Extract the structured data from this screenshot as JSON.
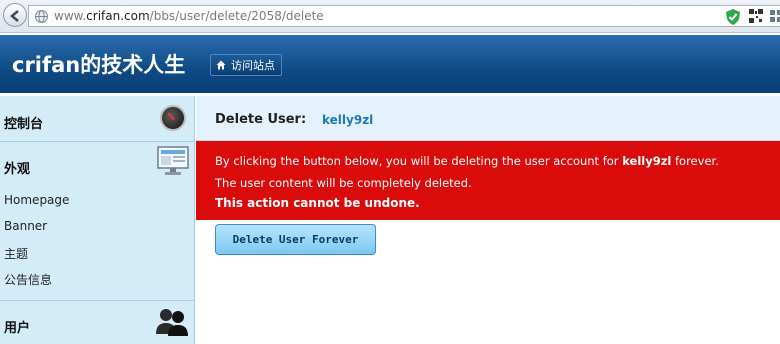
{
  "browser": {
    "url_prefix": "www.",
    "url_host": "crifan.com",
    "url_path": "/bbs/user/delete/2058/delete"
  },
  "header": {
    "site_title": "crifan的技术人生",
    "visit_site_label": "访问站点"
  },
  "sidebar": {
    "dashboard": "控制台",
    "appearance": "外观",
    "appearance_items": [
      "Homepage",
      "Banner",
      "主题",
      "公告信息"
    ],
    "users": "用户"
  },
  "main": {
    "delete_user_label": "Delete User:",
    "username": "kelly9zl",
    "warning": {
      "line1_before": "By clicking the button below, you will be deleting the user account for ",
      "line1_user": "kelly9zl",
      "line1_after": " forever.",
      "line2": "The user content will be completely deleted.",
      "line3": "This action cannot be undone."
    },
    "delete_button": "Delete User Forever"
  },
  "colors": {
    "header_blue": "#0f4a85",
    "sidebar_bg": "#d4ecf8",
    "warning_red": "#d90b0b",
    "username_link": "#1f7ab8"
  },
  "icons": {
    "back": "back-arrow-icon",
    "site": "globe-icon",
    "security": "shield-icon",
    "qr": "qr-code-icon",
    "home": "home-icon",
    "dashboard": "dial-icon",
    "appearance": "monitor-icon",
    "users": "users-icon"
  }
}
